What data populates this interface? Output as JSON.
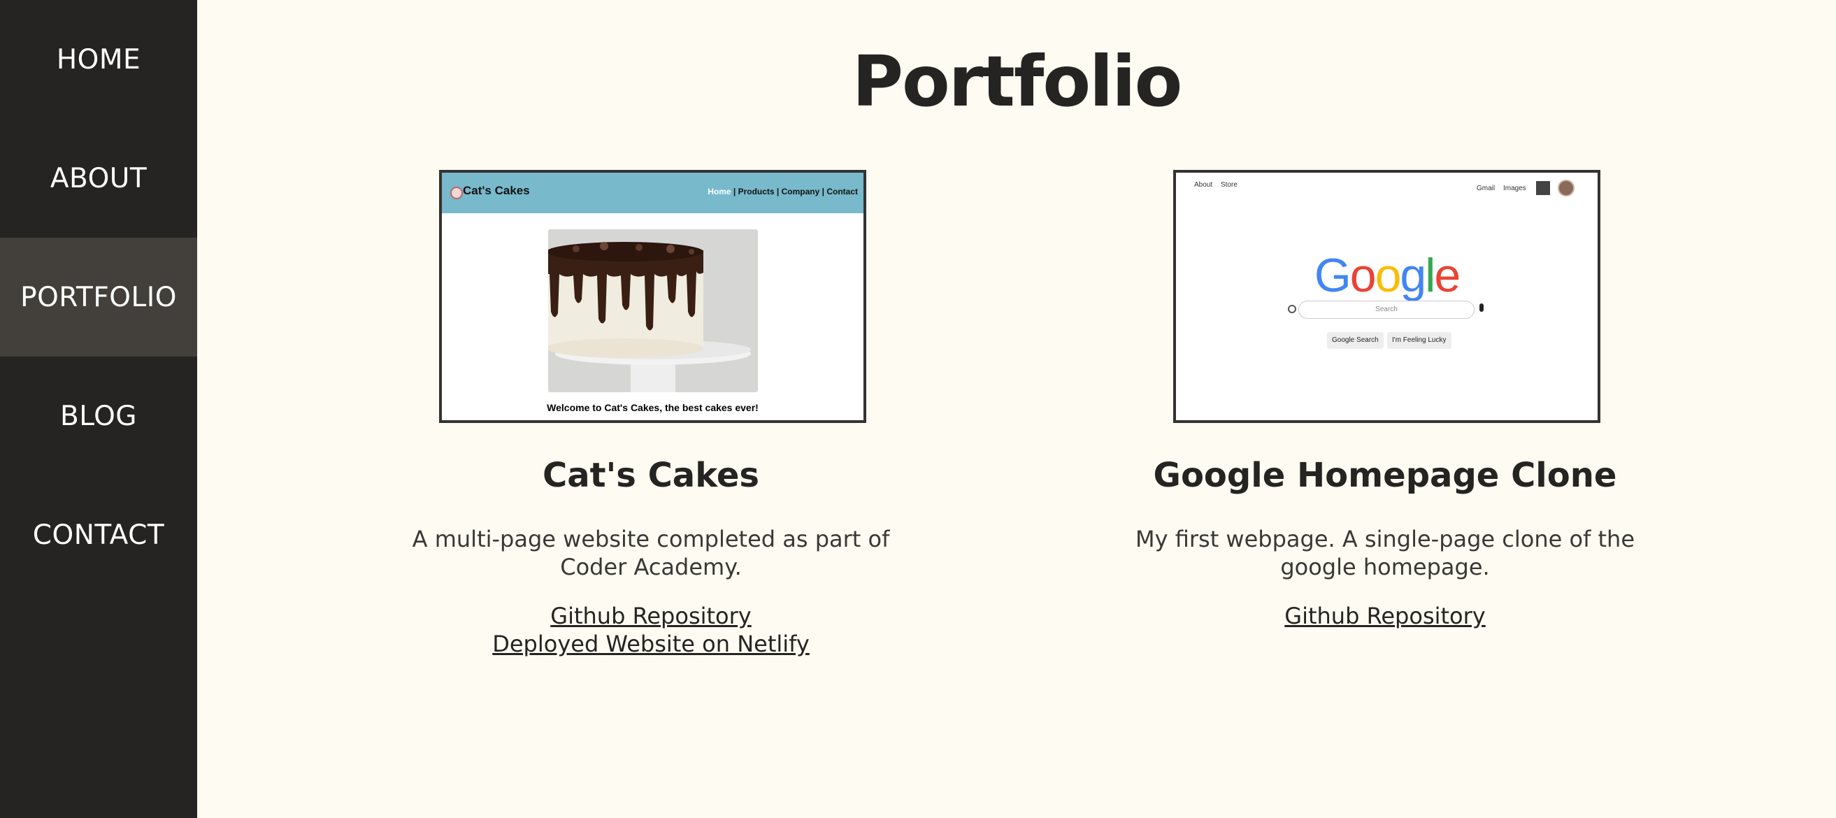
{
  "nav": {
    "home": "HOME",
    "about": "ABOUT",
    "portfolio": "PORTFOLIO",
    "blog": "BLOG",
    "contact": "CONTACT"
  },
  "page_title": "Portfolio",
  "projects": [
    {
      "title": "Cat's Cakes",
      "description": "A multi-page website completed as part of Coder Academy.",
      "links": [
        "Github Repository",
        "Deployed Website on Netlify"
      ],
      "screenshot": {
        "brand": "Cat's Cakes",
        "nav_current": "Home",
        "nav_rest": " | Products | Company | Contact",
        "caption": "Welcome to Cat's Cakes, the best cakes ever!"
      }
    },
    {
      "title": "Google Homepage Clone",
      "description": "My first webpage. A single-page clone of the google homepage.",
      "links": [
        "Github Repository"
      ],
      "screenshot": {
        "about": "About",
        "store": "Store",
        "gmail": "Gmail",
        "images": "Images",
        "logo": "Google",
        "search_placeholder": "Search",
        "button_search": "Google Search",
        "button_lucky": "I'm Feeling Lucky"
      }
    }
  ],
  "colors": {
    "sidebar_bg": "#252422",
    "sidebar_active": "#43403b",
    "page_bg": "#fefbf2",
    "cc_header": "#78b9cc"
  }
}
